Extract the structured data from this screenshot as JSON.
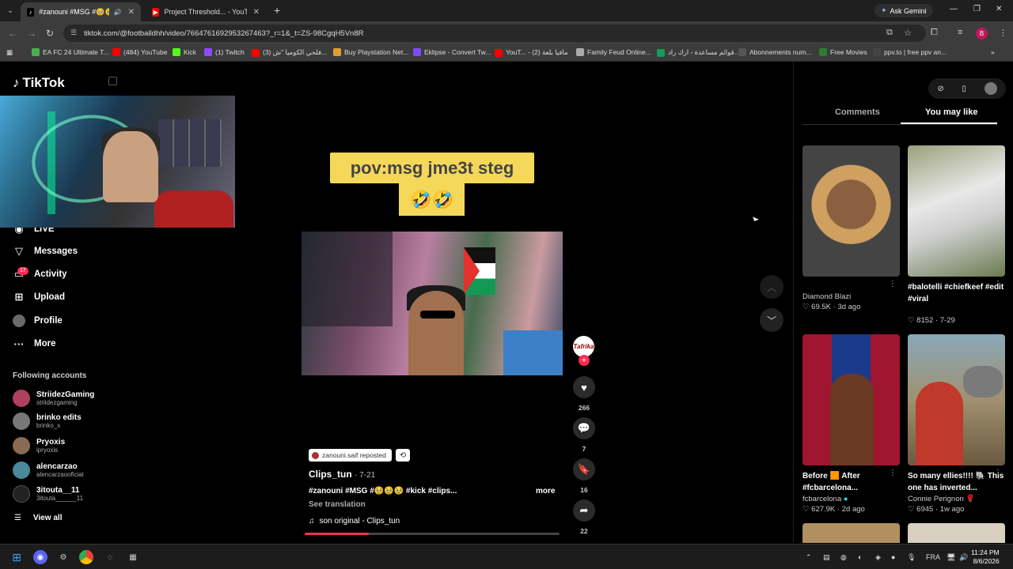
{
  "browser": {
    "tabs": [
      {
        "title": "#zanouni #MSG #🥹🥹🥹",
        "active": true
      },
      {
        "title": "Project Threshold... - YouTube",
        "active": false
      }
    ],
    "new_tab": "+",
    "gemini": "Ask Gemini",
    "url": "tiktok.com/@footballdhh/video/7664761692953267463?_r=1&_t=ZS-98CgqH5Vn8R",
    "profile_initial": "B",
    "bookmarks": [
      {
        "label": "EA FC 24 Ultimate T...",
        "color": "#4caf50"
      },
      {
        "label": "(484) YouTube",
        "color": "#ff0000"
      },
      {
        "label": "Kick",
        "color": "#53fc18"
      },
      {
        "label": "(1) Twitch",
        "color": "#9146ff"
      },
      {
        "label": "(3) فلحي الكوميا \"ش...",
        "color": "#ff0000"
      },
      {
        "label": "Buy Playstation Net...",
        "color": "#e0a030"
      },
      {
        "label": "Eklipse - Convert Tw...",
        "color": "#7b4dff"
      },
      {
        "label": "YouT... - مافيا بلعة (2)",
        "color": "#ff0000"
      },
      {
        "label": "Family Feud Online...",
        "color": "#aaaaaa"
      },
      {
        "label": "قوائم مساعدة - ارك راد...",
        "color": "#0f9d58"
      },
      {
        "label": "Abonnements num...",
        "color": "#555555"
      },
      {
        "label": "Free Movies",
        "color": "#2e7d32"
      },
      {
        "label": "ppv.to | free ppv an...",
        "color": "#444444"
      }
    ]
  },
  "sidebar": {
    "logo": "TikTok",
    "nav": [
      {
        "label": "LIVE",
        "icon": "live-icon"
      },
      {
        "label": "Messages",
        "icon": "messages-icon"
      },
      {
        "label": "Activity",
        "icon": "activity-icon"
      },
      {
        "label": "Upload",
        "icon": "upload-icon"
      },
      {
        "label": "Profile",
        "icon": "profile-icon"
      },
      {
        "label": "More",
        "icon": "more-icon"
      }
    ],
    "activity_badge": "17",
    "following_title": "Following accounts",
    "following": [
      {
        "name": "StriidezGaming",
        "handle": "striidezgaming",
        "color": "#b04060"
      },
      {
        "name": "brinko edits",
        "handle": "brinko_x",
        "color": "#777777"
      },
      {
        "name": "Pryoxis",
        "handle": "ipryoxis",
        "color": "#8a6a50"
      },
      {
        "name": "alencarzao",
        "handle": "alencarzaooficial",
        "color": "#4a8a9a"
      },
      {
        "name": "3itouta__11",
        "handle": "3itouta______11",
        "color": "#222222"
      }
    ],
    "view_all": "View all"
  },
  "video": {
    "caption_line1": "pov:msg jme3t steg",
    "caption_emoji": "🤣🤣",
    "repost_label": "zanouni.saif reposted",
    "author": "Clips_tun",
    "date": "· 7-21",
    "description": "#zanouni #MSG #🥹🥹🥹 #kick #clips...",
    "more": "more",
    "see_translation": "See translation",
    "music": "son original - Clips_tun",
    "progress": 0.25,
    "creator_avatar_text": "Tafrika",
    "likes": "266",
    "comments": "7",
    "saves": "16",
    "shares": "22"
  },
  "right_panel": {
    "tabs": [
      "Comments",
      "You may like"
    ],
    "active_tab": "You may like",
    "cards": [
      {
        "title": "",
        "author": "Diamond Blazi",
        "likes": "69.5K",
        "age": "3d ago"
      },
      {
        "title": "#balotelli #chiefkeef #edit #viral",
        "author": "",
        "likes": "8152",
        "age": "7-29"
      },
      {
        "title": "Before 🟧 After #fcbarcelona...",
        "author": "fcbarcelona",
        "likes": "627.9K",
        "age": "2d ago"
      },
      {
        "title": "So many ellies!!!! 🐘 This one has inverted...",
        "author": "Connie Perignon 🌹",
        "likes": "6945",
        "age": "1w ago"
      }
    ]
  },
  "taskbar": {
    "lang": "FRA",
    "time": "11:24 PM",
    "date": "8/6/2026"
  }
}
